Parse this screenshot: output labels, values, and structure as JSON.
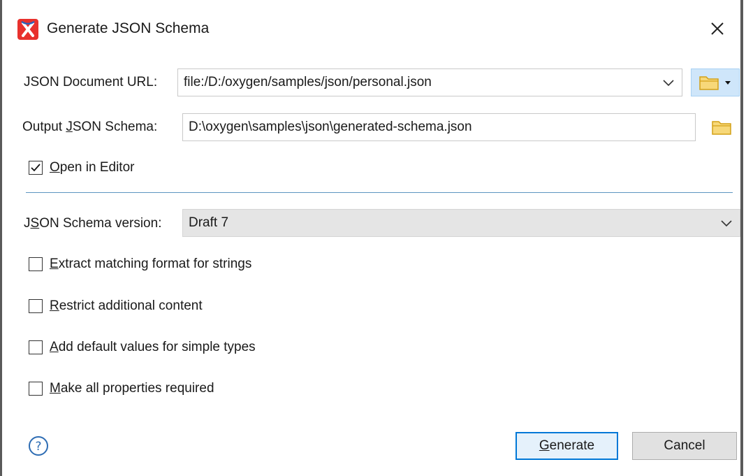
{
  "window": {
    "title": "Generate JSON Schema",
    "icon": "oxygen-x-icon",
    "close_icon": "close-icon"
  },
  "json_url": {
    "label": "JSON Document URL:",
    "value": "file:/D:/oxygen/samples/json/personal.json"
  },
  "output": {
    "label_pre": "Output ",
    "label_mn": "J",
    "label_post": "SON Schema:",
    "value": "D:\\oxygen\\samples\\json\\generated-schema.json"
  },
  "open_in_editor": {
    "mn": "O",
    "rest": "pen in Editor",
    "checked": true
  },
  "schema_version": {
    "label_pre": "J",
    "label_mn": "S",
    "label_post": "ON Schema version:",
    "value": "Draft 7"
  },
  "options": [
    {
      "mn": "E",
      "rest": "xtract matching format for strings",
      "checked": false
    },
    {
      "mn": "R",
      "rest": "estrict additional content",
      "checked": false
    },
    {
      "mn": "A",
      "rest": "dd default values for simple types",
      "checked": false
    },
    {
      "mn": "M",
      "rest": "ake all properties required",
      "checked": false
    }
  ],
  "buttons": {
    "generate_mn": "G",
    "generate_rest": "enerate",
    "cancel": "Cancel"
  },
  "colors": {
    "accent": "#0078d7",
    "separator": "#5d95c0",
    "folder": "#f2c241",
    "brand": "#e8312d"
  }
}
